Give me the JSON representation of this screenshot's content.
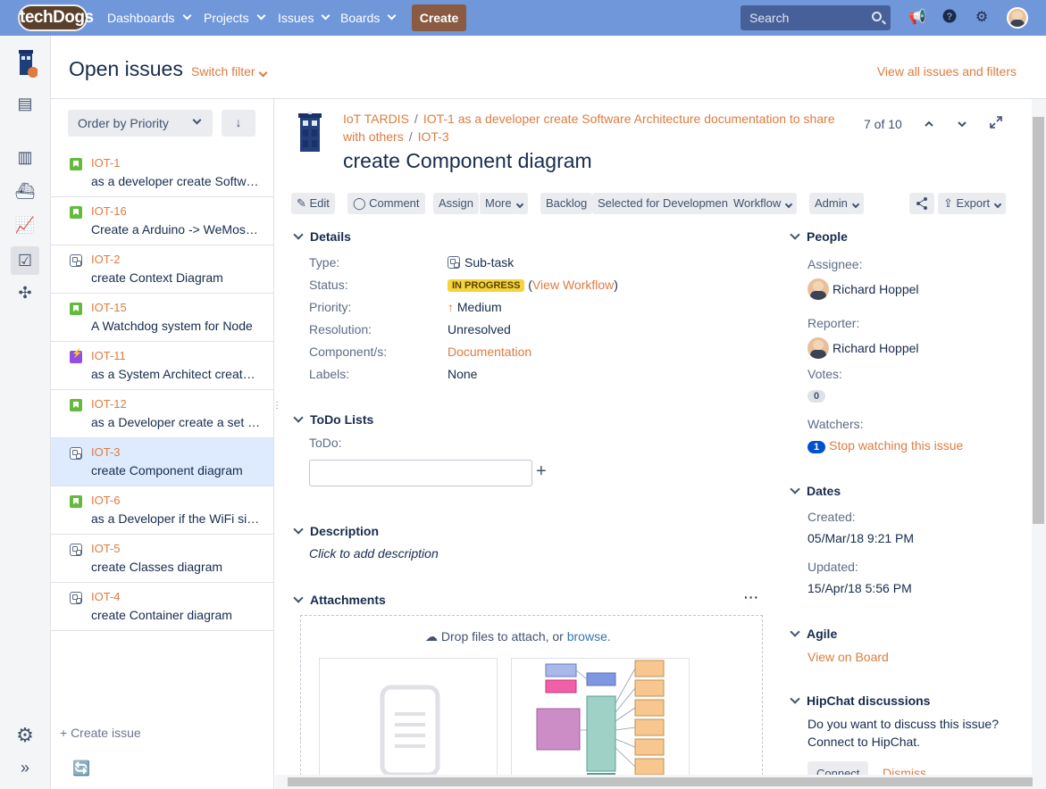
{
  "topbar": {
    "logo": "techDogs",
    "nav": [
      "Dashboards",
      "Projects",
      "Issues",
      "Boards"
    ],
    "create_label": "Create",
    "search_placeholder": "Search"
  },
  "header": {
    "title": "Open issues",
    "switch_filter": "Switch filter",
    "view_all": "View all issues and filters"
  },
  "list": {
    "order_label": "Order by Priority",
    "create_issue": "+ Create issue",
    "items": [
      {
        "key": "IOT-1",
        "summary": "as a developer create Software Architecture documentation to share with others",
        "type": "story"
      },
      {
        "key": "IOT-16",
        "summary": "Create a Arduino -> WeMos prototype",
        "type": "story"
      },
      {
        "key": "IOT-2",
        "summary": "create Context Diagram",
        "type": "sub"
      },
      {
        "key": "IOT-15",
        "summary": "A Watchdog system for Node",
        "type": "story"
      },
      {
        "key": "IOT-11",
        "summary": "as a System Architect create the overview",
        "type": "epic"
      },
      {
        "key": "IOT-12",
        "summary": "as a Developer create a set of tests",
        "type": "story"
      },
      {
        "key": "IOT-3",
        "summary": "create Component diagram",
        "type": "sub"
      },
      {
        "key": "IOT-6",
        "summary": "as a Developer if the WiFi signal drops",
        "type": "story"
      },
      {
        "key": "IOT-5",
        "summary": "create Classes diagram",
        "type": "sub"
      },
      {
        "key": "IOT-4",
        "summary": "create Container diagram",
        "type": "sub"
      }
    ]
  },
  "issue": {
    "project": "IoT TARDIS",
    "parent": "IOT-1 as a developer create Software Architecture documentation to share with others",
    "key": "IOT-3",
    "title": "create Component diagram",
    "pager": "7 of 10",
    "toolbar": {
      "edit": "Edit",
      "comment": "Comment",
      "assign": "Assign",
      "more": "More",
      "backlog": "Backlog",
      "selected": "Selected for Development",
      "workflow": "Workflow",
      "admin": "Admin",
      "export": "Export"
    },
    "details": {
      "heading": "Details",
      "type_label": "Type:",
      "type": "Sub-task",
      "status_label": "Status:",
      "status": "IN PROGRESS",
      "view_workflow": "View Workflow",
      "priority_label": "Priority:",
      "priority": "Medium",
      "resolution_label": "Resolution:",
      "resolution": "Unresolved",
      "component_label": "Component/s:",
      "component": "Documentation",
      "labels_label": "Labels:",
      "labels": "None"
    },
    "todo": {
      "heading": "ToDo Lists",
      "label": "ToDo:"
    },
    "description": {
      "heading": "Description",
      "placeholder": "Click to add description"
    },
    "attachments": {
      "heading": "Attachments",
      "drop_text": "Drop files to attach, or",
      "browse": "browse."
    },
    "people": {
      "heading": "People",
      "assignee_label": "Assignee:",
      "assignee": "Richard Hoppel",
      "reporter_label": "Reporter:",
      "reporter": "Richard Hoppel",
      "votes_label": "Votes:",
      "votes": "0",
      "watchers_label": "Watchers:",
      "watchers": "1",
      "stop_watching": "Stop watching this issue"
    },
    "dates": {
      "heading": "Dates",
      "created_label": "Created:",
      "created": "05/Mar/18 9:21 PM",
      "updated_label": "Updated:",
      "updated": "15/Apr/18 5:56 PM"
    },
    "agile": {
      "heading": "Agile",
      "view_on_board": "View on Board"
    },
    "hipchat": {
      "heading": "HipChat discussions",
      "question": "Do you want to discuss this issue?",
      "connect_text": "Connect to HipChat.",
      "connect_btn": "Connect",
      "dismiss": "Dismiss"
    }
  },
  "colors": {
    "topbar": "#6f97d9",
    "accent": "#de7b3f",
    "create": "#8a5a43"
  }
}
